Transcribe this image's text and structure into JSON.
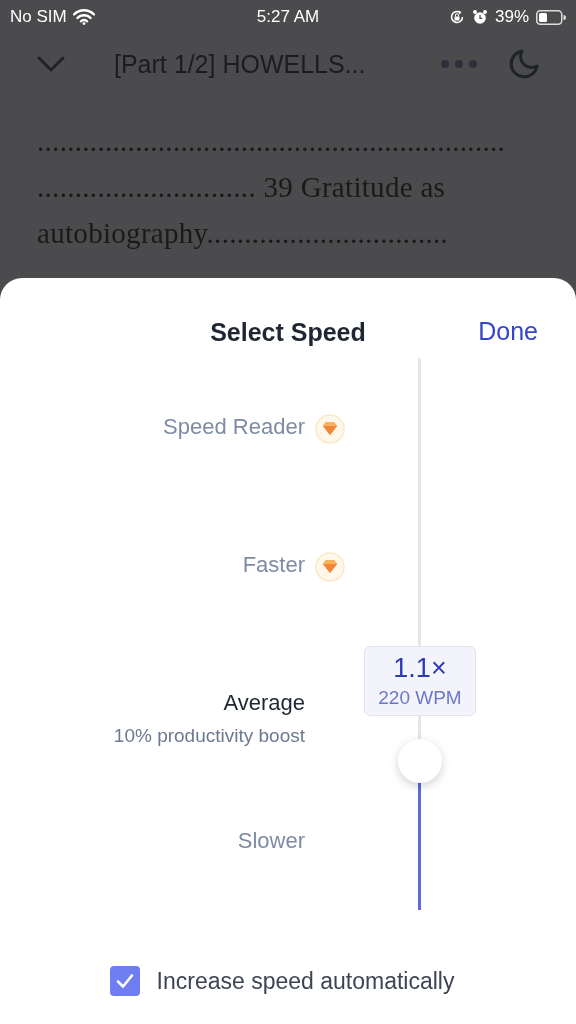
{
  "status_bar": {
    "carrier": "No SIM",
    "time": "5:27 AM",
    "battery": "39%"
  },
  "reader": {
    "title": "[Part 1/2] HOWELLS...",
    "lines": [
      "..............................................................",
      "............................. 39 Gratitude as",
      "autobiography................................"
    ]
  },
  "speed_sheet": {
    "title": "Select Speed",
    "done": "Done",
    "options": [
      {
        "label": "Speed Reader",
        "premium": true,
        "selected": false
      },
      {
        "label": "Faster",
        "premium": true,
        "selected": false
      },
      {
        "label": "Average",
        "subtitle": "10% productivity boost",
        "premium": false,
        "selected": true
      },
      {
        "label": "Slower",
        "premium": false,
        "selected": false
      }
    ],
    "slider": {
      "level": 0.27,
      "value": "1.1×",
      "wpm": "220 WPM"
    },
    "auto_increase": {
      "label": "Increase speed automatically",
      "checked": true
    }
  }
}
